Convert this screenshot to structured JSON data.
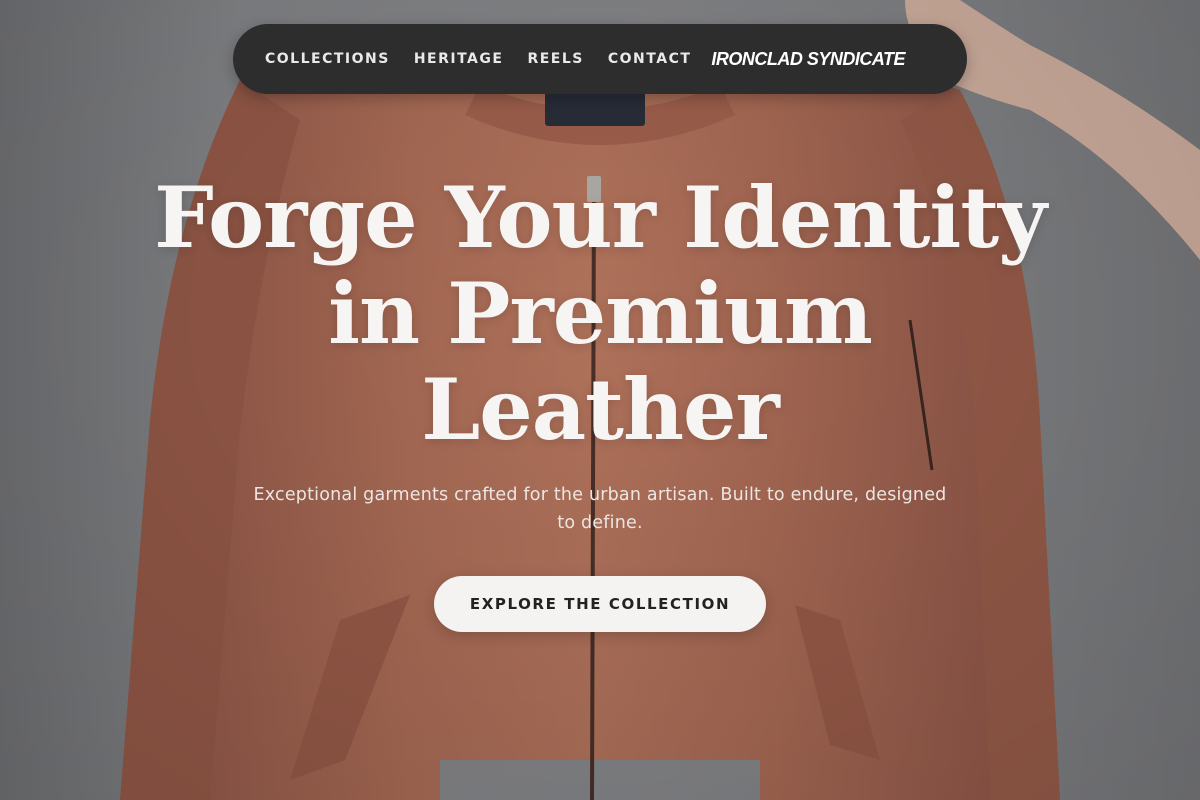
{
  "nav": {
    "links": [
      "COLLECTIONS",
      "HERITAGE",
      "REELS",
      "CONTACT"
    ],
    "brand": "IRONCLAD SYNDICATE"
  },
  "hero": {
    "title_lines": [
      "Forge Your Identity",
      "in Premium",
      "Leather"
    ],
    "subtitle": "Exceptional garments crafted for the urban artisan. Built to endure, designed to define.",
    "cta_label": "EXPLORE THE COLLECTION",
    "background_image": "rust-bomber-jacket-on-hanger"
  },
  "colors": {
    "nav_background": "#2d2d2e",
    "jacket": "#b0705a",
    "wall": "#8b8c8f",
    "cta_background": "#f4f3f2",
    "title_text": "#f7f5f3"
  }
}
